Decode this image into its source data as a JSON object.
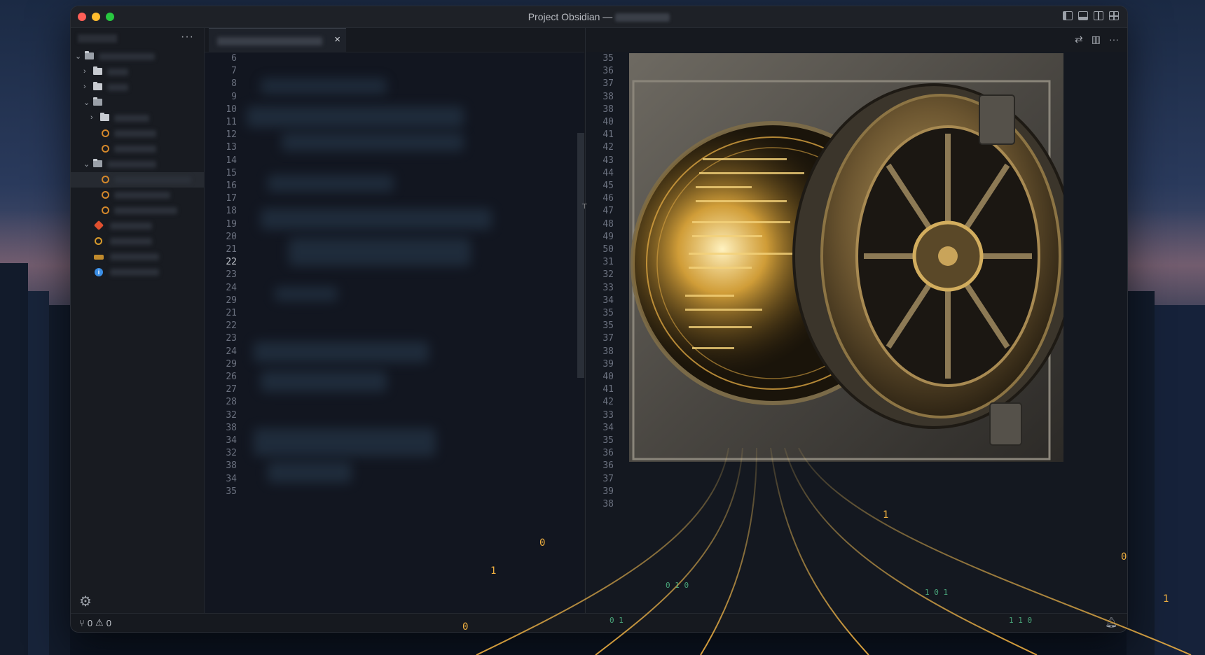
{
  "window": {
    "title": "Project Obsidian —"
  },
  "editor": {
    "tab_close_label": "×",
    "line_numbers": [
      "6",
      "7",
      "8",
      "9",
      "10",
      "11",
      "12",
      "13",
      "14",
      "15",
      "16",
      "17",
      "18",
      "19",
      "20",
      "21",
      "22",
      "23",
      "24",
      "29",
      "21",
      "22",
      "23",
      "24",
      "29",
      "26",
      "27",
      "28",
      "32",
      "38",
      "34",
      "32",
      "38",
      "34",
      "35"
    ],
    "current_line": "22"
  },
  "right_pane": {
    "line_numbers": [
      "35",
      "36",
      "37",
      "38",
      "38",
      "40",
      "41",
      "42",
      "43",
      "44",
      "45",
      "46",
      "47",
      "48",
      "49",
      "50",
      "31",
      "32",
      "33",
      "34",
      "35",
      "35",
      "37",
      "38",
      "39",
      "40",
      "41",
      "42",
      "33",
      "34",
      "35",
      "36",
      "36",
      "37",
      "39",
      "38"
    ]
  },
  "sidebar": {
    "more_label": "···"
  },
  "statusbar": {
    "branch_count": "0",
    "warning_count": "0"
  },
  "icons": [
    "gear-icon",
    "bell-icon",
    "branch-icon",
    "warning-icon",
    "folder-icon",
    "chevron-right-icon",
    "chevron-down-icon",
    "close-icon",
    "more-icon",
    "toggle-sidebar-icon",
    "toggle-panel-icon",
    "split-editor-icon",
    "customize-layout-icon",
    "compare-icon"
  ],
  "colors": {
    "accent_gold": "#e0a93a",
    "code_green": "#5fe0a0"
  }
}
